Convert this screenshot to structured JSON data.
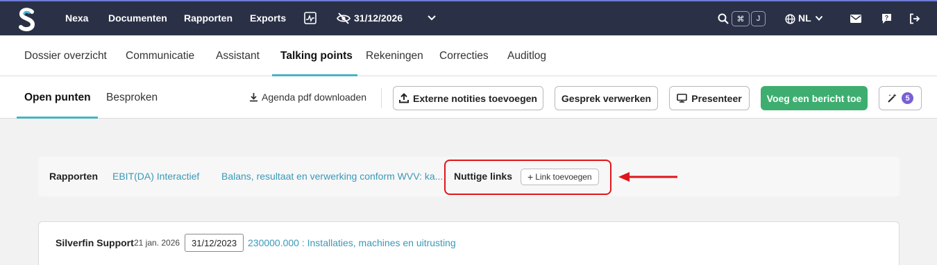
{
  "navbar": {
    "items": [
      "Nexa",
      "Documenten",
      "Rapporten",
      "Exports"
    ],
    "date": "31/12/2026",
    "shortcut_keys": [
      "⌘",
      "J"
    ],
    "language": "NL",
    "icons": [
      "logo-icon",
      "activity-icon",
      "eye-slash-icon",
      "chevron-down-icon",
      "search-icon",
      "globe-icon",
      "envelope-icon",
      "help-icon",
      "logout-icon"
    ],
    "colors": {
      "background": "#2a3147",
      "accent": "#6f7bd6"
    }
  },
  "main_tabs": {
    "items": [
      "Dossier overzicht",
      "Communicatie",
      "Assistant",
      "Talking points",
      "Rekeningen",
      "Correcties",
      "Auditlog"
    ],
    "active": "Talking points",
    "underline_color": "#45b5c4"
  },
  "sub_tabs": {
    "items": [
      "Open punten",
      "Besproken"
    ],
    "active": "Open punten"
  },
  "toolbar": {
    "download_label": "Agenda pdf downloaden",
    "external_notes_label": "Externe notities toevoegen",
    "process_label": "Gesprek verwerken",
    "present_label": "Presenteer",
    "add_message_label": "Voeg een bericht toe",
    "ai_badge_count": "5",
    "green_color": "#3dae6f"
  },
  "links_bar": {
    "reports_label": "Rapporten",
    "report_links": [
      "EBIT(DA) Interactief",
      "Balans, resultaat en verwerking conform WVV: ka..."
    ],
    "useful_links_label": "Nuttige links",
    "add_link_label": "Link toevoegen",
    "highlight_color": "#e0151b"
  },
  "message": {
    "author": "Silverfin Support",
    "date": "21 jan. 2026",
    "period_tag": "31/12/2023",
    "account_link": "230000.000 : Installaties, machines en uitrusting"
  }
}
